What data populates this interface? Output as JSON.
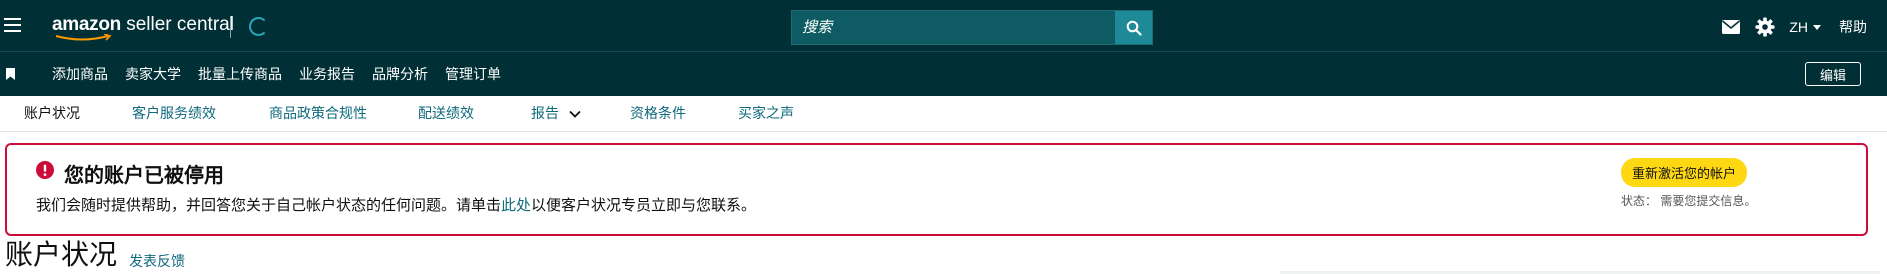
{
  "topbar": {
    "brand": {
      "name_bold": "amazon",
      "name_rest": " seller central"
    },
    "search": {
      "placeholder": "搜索"
    },
    "icons": [
      "hamburger-menu-icon",
      "loading-spinner-icon",
      "search-icon",
      "mail-icon",
      "gear-icon"
    ],
    "language": "ZH",
    "help": "帮助",
    "colors": {
      "bar": "#002f36",
      "search_button": "#1f8a97"
    }
  },
  "navbar": {
    "links": [
      "添加商品",
      "卖家大学",
      "批量上传商品",
      "业务报告",
      "品牌分析",
      "管理订单"
    ],
    "edit_label": "编辑"
  },
  "tabs": [
    {
      "label": "账户状况",
      "active": true
    },
    {
      "label": "客户服务绩效",
      "active": false
    },
    {
      "label": "商品政策合规性",
      "active": false
    },
    {
      "label": "配送绩效",
      "active": false
    },
    {
      "label": "报告",
      "active": false,
      "has_dropdown": true
    },
    {
      "label": "资格条件",
      "active": false
    },
    {
      "label": "买家之声",
      "active": false
    }
  ],
  "alert": {
    "title": "您的账户已被停用",
    "body_before": "我们会随时提供帮助，并回答您关于自己帐户状态的任何问题。请单击",
    "body_link": "此处",
    "body_after": "以便客户状况专员立即与您联系。",
    "button_label": "重新激活您的帐户",
    "status_text": "状态：  需要您提交信息。",
    "colors": {
      "border": "#cc0c39",
      "button": "#ffd814"
    }
  },
  "page": {
    "title": "账户状况",
    "feedback_link": "发表反馈"
  }
}
